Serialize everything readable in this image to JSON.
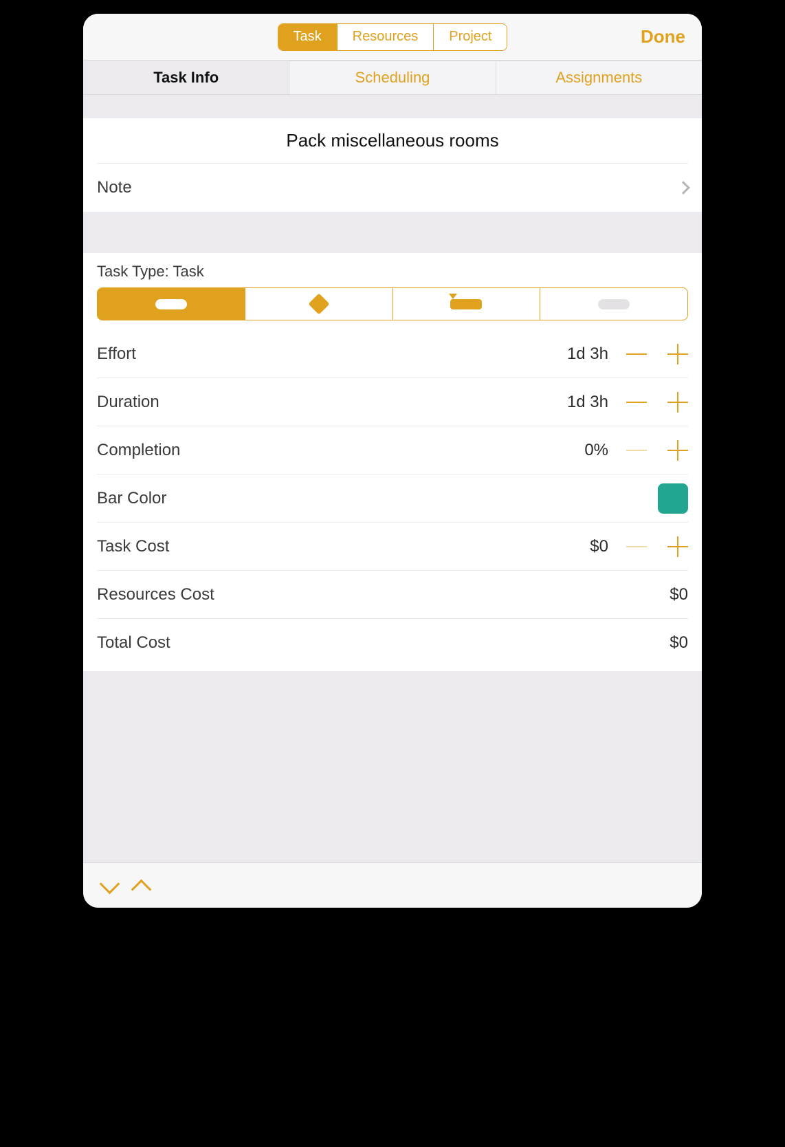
{
  "colors": {
    "accent": "#e0a21e",
    "barColor": "#22a591"
  },
  "toolbar": {
    "segments": [
      "Task",
      "Resources",
      "Project"
    ],
    "activeSegment": 0,
    "done": "Done"
  },
  "subtabs": {
    "items": [
      "Task Info",
      "Scheduling",
      "Assignments"
    ],
    "active": 0
  },
  "task": {
    "title": "Pack miscellaneous rooms",
    "note_label": "Note"
  },
  "taskType": {
    "header_prefix": "Task Type: ",
    "header_value": "Task",
    "options": [
      "task",
      "milestone",
      "hammock",
      "group"
    ],
    "active": 0
  },
  "rows": {
    "effort": {
      "label": "Effort",
      "value": "1d 3h",
      "minusEnabled": true
    },
    "duration": {
      "label": "Duration",
      "value": "1d 3h",
      "minusEnabled": true
    },
    "completion": {
      "label": "Completion",
      "value": "0%",
      "minusEnabled": false
    },
    "barColor": {
      "label": "Bar Color"
    },
    "taskCost": {
      "label": "Task Cost",
      "value": "$0",
      "minusEnabled": false
    },
    "resourcesCost": {
      "label": "Resources Cost",
      "value": "$0"
    },
    "totalCost": {
      "label": "Total Cost",
      "value": "$0"
    }
  }
}
